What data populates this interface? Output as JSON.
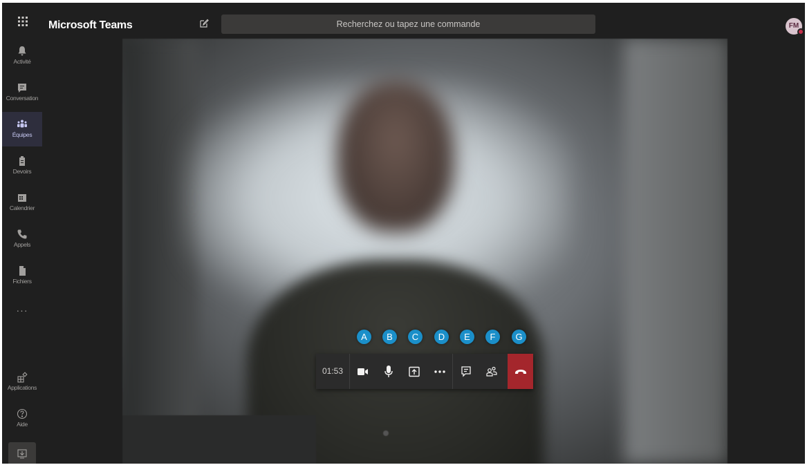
{
  "topbar": {
    "app_title": "Microsoft Teams",
    "search_placeholder": "Recherchez ou tapez une commande",
    "avatar_initials": "FM"
  },
  "sidebar": {
    "items": [
      {
        "label": "Activité",
        "icon": "bell-icon"
      },
      {
        "label": "Conversation",
        "icon": "chat-icon"
      },
      {
        "label": "Équipes",
        "icon": "teams-icon",
        "active": true
      },
      {
        "label": "Devoirs",
        "icon": "assignments-icon"
      },
      {
        "label": "Calendrier",
        "icon": "calendar-icon"
      },
      {
        "label": "Appels",
        "icon": "phone-icon"
      },
      {
        "label": "Fichiers",
        "icon": "files-icon"
      }
    ],
    "more": "···",
    "bottom_items": [
      {
        "label": "Applications",
        "icon": "apps-icon"
      },
      {
        "label": "Aide",
        "icon": "help-icon"
      }
    ]
  },
  "call": {
    "timer": "01:53",
    "markers": [
      "A",
      "B",
      "C",
      "D",
      "E",
      "F",
      "G"
    ]
  },
  "colors": {
    "accent": "#6264a7",
    "hangup": "#a4262c",
    "marker": "#1b8fc9"
  }
}
